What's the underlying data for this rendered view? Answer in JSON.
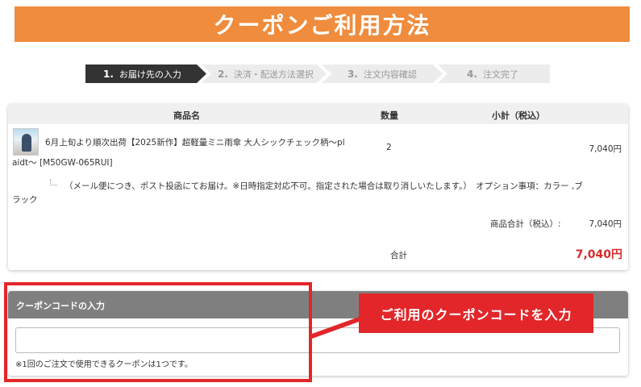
{
  "banner": {
    "title": "クーポンご利用方法"
  },
  "steps": [
    {
      "num": "1.",
      "label": "お届け先の入力"
    },
    {
      "num": "2.",
      "label": "決済・配送方法選択"
    },
    {
      "num": "3.",
      "label": "注文内容確認"
    },
    {
      "num": "4.",
      "label": "注文完了"
    }
  ],
  "cart": {
    "headers": {
      "product": "商品名",
      "quantity": "数量",
      "subtotal": "小計（税込）"
    },
    "item": {
      "name_line1": "6月上旬より順次出荷【2025新作】超軽量ミニ雨傘 大人シックチェック柄～pl",
      "name_line2": "aidt～ [M50GW-065RUI]",
      "quantity": "2",
      "price": "7,040円",
      "note_line1": "（メール便につき、ポスト投函にてお届け。※日時指定対応不可。指定された場合は取り消しいたします。）　オプション事項：カラー ,ブ",
      "note_line2": "ラック"
    },
    "subtotal_label": "商品合計（税込）:",
    "subtotal_value": "7,040円",
    "total_label": "合計",
    "total_value": "7,040円"
  },
  "coupon": {
    "title": "クーポンコードの入力",
    "input_value": "",
    "note": "※1回のご注文で使用できるクーポンは1つです。"
  },
  "callout": {
    "text": "ご利用のクーポンコードを入力"
  },
  "colors": {
    "banner": "#ef8c3d",
    "highlight": "#e2262a",
    "total": "#d52b2b",
    "active_step": "#333333"
  }
}
